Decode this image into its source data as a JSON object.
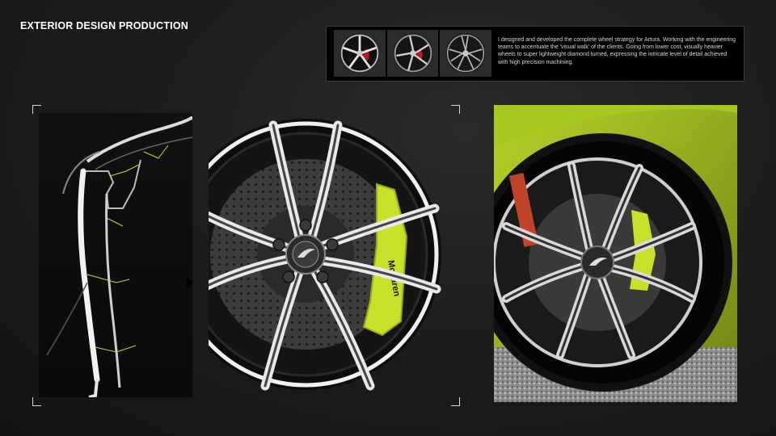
{
  "header": {
    "title": "EXTERIOR DESIGN PRODUCTION"
  },
  "strip": {
    "description": "I designed and developed the complete wheel strategy for Artura. Working with the engineering teams to accentuate the 'visual walk' of the clients. Going from lower cost, visually heavier wheels to super lightweight diamond turned, expressing the intricate level of detail achieved with high precision machining.",
    "thumbnails": [
      "wheel-variant-1",
      "wheel-variant-2",
      "wheel-variant-3"
    ]
  },
  "colors": {
    "accent": "#c5dc2a",
    "caliper": "#c8e02a",
    "caliper_red": "#c0181c",
    "background": "#1b1b1b"
  },
  "images": [
    "wheel-sketch",
    "wheel-render",
    "wheel-photo"
  ]
}
